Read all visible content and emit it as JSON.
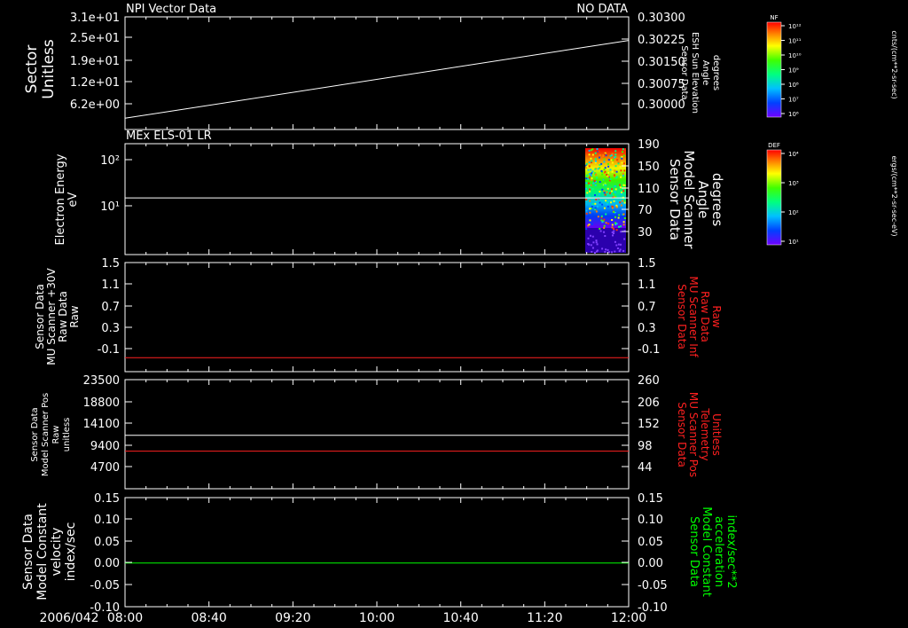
{
  "date_label": "2006/042",
  "time_ticks": [
    "08:00",
    "08:40",
    "09:20",
    "10:00",
    "10:40",
    "11:20",
    "12:00"
  ],
  "panels": [
    {
      "title_left": "NPI Vector Data",
      "title_right": "NO DATA",
      "left_label": [
        "Sector",
        "Unitless"
      ],
      "right_label": [
        "Sensor Data",
        "ESH Sun Elevation",
        "Angle",
        "degrees"
      ],
      "right_label_color": "#ffffff",
      "left_ticks": [
        "3.1e+01",
        "2.5e+01",
        "1.9e+01",
        "1.2e+01",
        "6.2e+00"
      ],
      "right_ticks": [
        "0.30300",
        "0.30225",
        "0.30150",
        "0.30075",
        "0.30000"
      ]
    },
    {
      "title_left": "MEx ELS-01 LR",
      "left_label": [
        "Electron Energy",
        "eV"
      ],
      "right_label": [
        "Sensor Data",
        "Model Scanner",
        "Angle",
        "degrees"
      ],
      "right_label_color": "#ffffff",
      "left_ticks": [
        "10²",
        "10¹"
      ],
      "right_ticks": [
        "190",
        "150",
        "110",
        "70",
        "30"
      ]
    },
    {
      "left_label": [
        "Sensor Data",
        "MU Scanner +30V",
        "Raw Data",
        "Raw"
      ],
      "right_label": [
        "Sensor Data",
        "MU Scanner Inf",
        "Raw Data",
        "Raw"
      ],
      "right_label_color": "#ff2020",
      "left_ticks": [
        "1.5",
        "1.1",
        "0.7",
        "0.3",
        "-0.1"
      ],
      "right_ticks": [
        "1.5",
        "1.1",
        "0.7",
        "0.3",
        "-0.1"
      ]
    },
    {
      "left_label": [
        "Sensor Data",
        "Model Scanner Pos",
        "Raw",
        "unitless"
      ],
      "right_label": [
        "Sensor Data",
        "MU Scanner Pos",
        "Telemetry",
        "Unitless"
      ],
      "right_label_color": "#ff2020",
      "left_ticks": [
        "23500",
        "18800",
        "14100",
        "9400",
        "4700"
      ],
      "right_ticks": [
        "260",
        "206",
        "152",
        "98",
        "44"
      ]
    },
    {
      "left_label": [
        "Sensor Data",
        "Model Constant",
        "velocity",
        "index/sec"
      ],
      "right_label": [
        "Sensor Data",
        "Model Constant",
        "acceleration",
        "index/sec**2"
      ],
      "right_label_color": "#00ff00",
      "left_ticks": [
        "0.15",
        "0.10",
        "0.05",
        "0.00",
        "-0.05",
        "-0.10"
      ],
      "right_ticks": [
        "0.15",
        "0.10",
        "0.05",
        "0.00",
        "-0.05",
        "-0.10"
      ]
    }
  ],
  "colorbars": [
    {
      "title": "NF",
      "unit": "cnts/(cm**2-sr-sec)",
      "ticks": [
        "10¹²",
        "10¹¹",
        "10¹⁰",
        "10⁹",
        "10⁸",
        "10⁷",
        "10⁶"
      ]
    },
    {
      "title": "DEF",
      "unit": "ergs/(cm**2-sr-sec-eV)",
      "ticks": [
        "10⁴",
        "10³",
        "10²",
        "10¹"
      ]
    }
  ],
  "chart_data": {
    "type": "line",
    "x_range": [
      "08:00",
      "12:00"
    ],
    "panels": [
      {
        "series": [
          {
            "color": "#ffffff",
            "x": [
              "08:00",
              "12:00"
            ],
            "y": [
              3.1,
              24.5
            ]
          }
        ],
        "ylim": [
          0,
          31
        ]
      },
      {
        "series": [
          {
            "color": "#ffffff",
            "x": [
              "08:00",
              "12:00"
            ],
            "y": [
              15,
              15
            ]
          }
        ],
        "ylim_log": [
          1,
          200
        ],
        "spectrogram": {
          "x_start": "11:30",
          "x_end": "12:00"
        }
      },
      {
        "series": [
          {
            "color": "#ff2020",
            "x": [
              "08:00",
              "12:00"
            ],
            "y": [
              -0.07,
              -0.07
            ]
          }
        ],
        "ylim": [
          -0.3,
          1.5
        ]
      },
      {
        "series": [
          {
            "color": "#ffffff",
            "x": [
              "08:00",
              "12:00"
            ],
            "y": [
              11500,
              11500
            ]
          },
          {
            "color": "#ff2020",
            "x": [
              "08:00",
              "12:00"
            ],
            "y": [
              8100,
              8100
            ]
          }
        ],
        "ylim": [
          0,
          23500
        ]
      },
      {
        "series": [
          {
            "color": "#00ff00",
            "x": [
              "08:00",
              "12:00"
            ],
            "y": [
              0,
              0
            ]
          }
        ],
        "ylim": [
          -0.1,
          0.15
        ]
      }
    ]
  }
}
